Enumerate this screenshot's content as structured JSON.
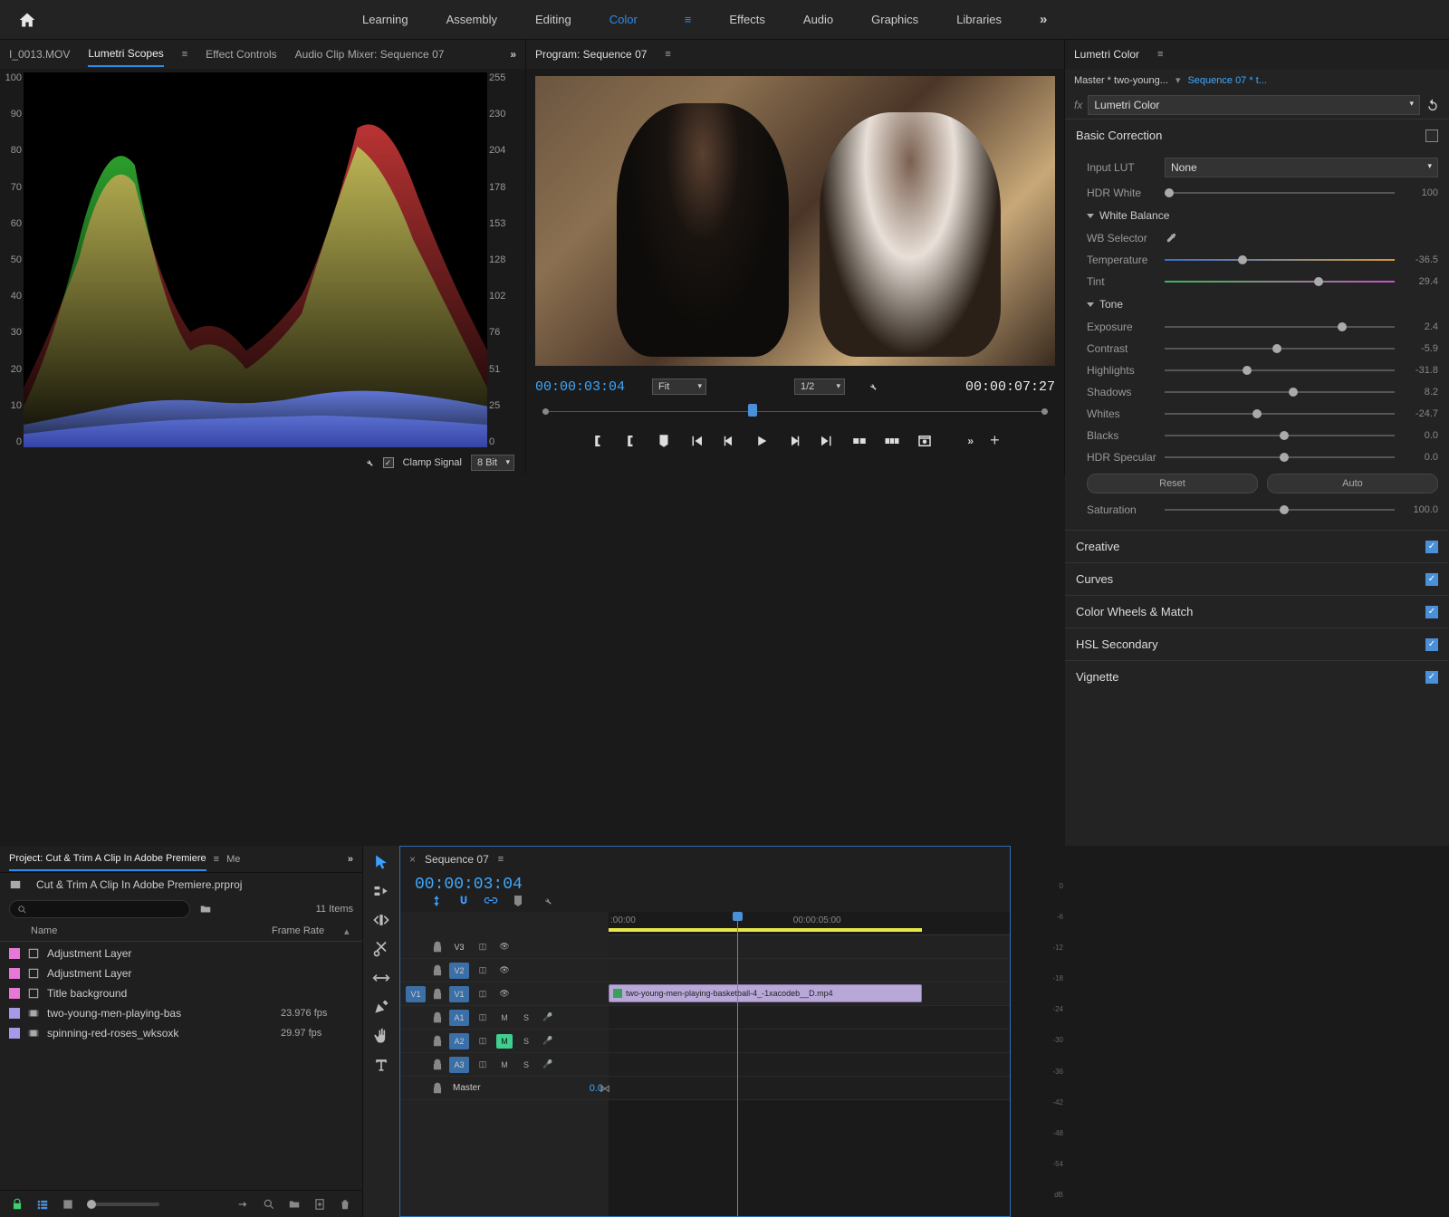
{
  "workspaces": [
    "Learning",
    "Assembly",
    "Editing",
    "Color",
    "Effects",
    "Audio",
    "Graphics",
    "Libraries"
  ],
  "workspace_active": "Color",
  "scopes": {
    "panel_tab_plain": "I_0013.MOV",
    "panel_tab_active": "Lumetri Scopes",
    "panel_tab_ec": "Effect Controls",
    "panel_tab_mix": "Audio Clip Mixer: Sequence 07",
    "axis_left": [
      "100",
      "90",
      "80",
      "70",
      "60",
      "50",
      "40",
      "30",
      "20",
      "10",
      "0"
    ],
    "axis_right": [
      "255",
      "230",
      "204",
      "178",
      "153",
      "128",
      "102",
      "76",
      "51",
      "25",
      "0"
    ],
    "clamp_label": "Clamp Signal",
    "bitdepth": "8 Bit"
  },
  "program": {
    "title": "Program: Sequence 07",
    "tc_in": "00:00:03:04",
    "fit": "Fit",
    "res": "1/2",
    "tc_out": "00:00:07:27"
  },
  "lumetri": {
    "title": "Lumetri Color",
    "master_a": "Master * two-young...",
    "master_b": "Sequence 07 * t...",
    "fx_label": "Lumetri Color",
    "basic": {
      "title": "Basic Correction",
      "input_lut_label": "Input LUT",
      "input_lut": "None",
      "hdr_white_label": "HDR White",
      "hdr_white": "100",
      "wb_head": "White Balance",
      "wb_sel": "WB Selector",
      "temp_label": "Temperature",
      "temp": "-36.5",
      "tint_label": "Tint",
      "tint": "29.4",
      "tone_head": "Tone",
      "exposure_label": "Exposure",
      "exposure": "2.4",
      "contrast_label": "Contrast",
      "contrast": "-5.9",
      "highlights_label": "Highlights",
      "highlights": "-31.8",
      "shadows_label": "Shadows",
      "shadows": "8.2",
      "whites_label": "Whites",
      "whites": "-24.7",
      "blacks_label": "Blacks",
      "blacks": "0.0",
      "hdrspec_label": "HDR Specular",
      "hdrspec": "0.0",
      "reset": "Reset",
      "auto": "Auto",
      "saturation_label": "Saturation",
      "saturation": "100.0"
    },
    "sections": [
      "Creative",
      "Curves",
      "Color Wheels & Match",
      "HSL Secondary",
      "Vignette"
    ]
  },
  "project": {
    "tab": "Project: Cut & Trim A Clip In Adobe Premiere",
    "tab2": "Me",
    "filename": "Cut & Trim A Clip In Adobe Premiere.prproj",
    "items_count": "11 Items",
    "col_name": "Name",
    "col_fr": "Frame Rate",
    "rows": [
      {
        "color": "#e878d8",
        "icon": "adj",
        "name": "Adjustment Layer",
        "fr": ""
      },
      {
        "color": "#e878d8",
        "icon": "adj",
        "name": "Adjustment Layer",
        "fr": ""
      },
      {
        "color": "#e878d8",
        "icon": "adj",
        "name": "Title background",
        "fr": ""
      },
      {
        "color": "#a898e8",
        "icon": "vid",
        "name": "two-young-men-playing-bas",
        "fr": "23.976 fps"
      },
      {
        "color": "#a898e8",
        "icon": "vid",
        "name": "spinning-red-roses_wksoxk",
        "fr": "29.97 fps"
      }
    ]
  },
  "timeline": {
    "tab": "Sequence 07",
    "tc": "00:00:03:04",
    "ruler": [
      ":00:00",
      "00:00:05:00"
    ],
    "video_tracks": [
      "V3",
      "V2",
      "V1"
    ],
    "audio_tracks": [
      "A1",
      "A2",
      "A3"
    ],
    "master": "Master",
    "master_val": "0.0",
    "clip_name": "two-young-men-playing-basketball-4_-1xacodeb__D.mp4",
    "meter_scale": [
      "0",
      "-6",
      "-12",
      "-18",
      "-24",
      "-30",
      "-36",
      "-42",
      "-48",
      "-54",
      "dB"
    ]
  }
}
